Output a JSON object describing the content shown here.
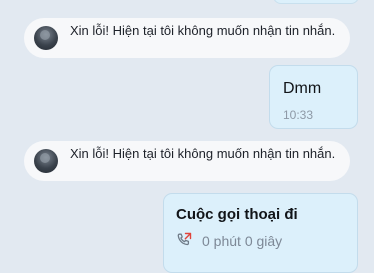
{
  "messages": {
    "system_reply_1": "Xin lỗi! Hiện tại tôi không muốn nhận tin nhắn.",
    "user_message": {
      "text": "Dmm",
      "time": "10:33"
    },
    "system_reply_2": "Xin lỗi! Hiện tại tôi không muốn nhận tin nhắn.",
    "call": {
      "title": "Cuộc gọi thoại đi",
      "duration": "0 phút 0 giây",
      "icon": "missed-outgoing-call-icon"
    }
  },
  "colors": {
    "background": "#e2e9f1",
    "sent_bubble": "#dcf0fb",
    "received_bubble": "#f7f8fa",
    "call_icon": "#e0443c"
  }
}
